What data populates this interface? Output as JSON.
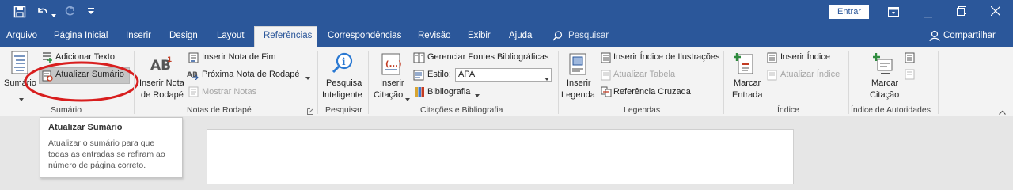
{
  "titlebar": {
    "signin_label": "Entrar"
  },
  "tabs": {
    "arquivo": "Arquivo",
    "pagina_inicial": "Página Inicial",
    "inserir": "Inserir",
    "design": "Design",
    "layout": "Layout",
    "referencias": "Referências",
    "correspondencias": "Correspondências",
    "revisao": "Revisão",
    "exibir": "Exibir",
    "ajuda": "Ajuda",
    "search_label": "Pesquisar",
    "share_label": "Compartilhar"
  },
  "ribbon": {
    "sumario": {
      "button_label": "Sumário",
      "adicionar_texto": "Adicionar Texto",
      "atualizar_sumario": "Atualizar Sumário",
      "group_label": "Sumário"
    },
    "notas": {
      "inserir_nota_rodape_line1": "Inserir Nota",
      "inserir_nota_rodape_line2": "de Rodapé",
      "inserir_nota_fim": "Inserir Nota de Fim",
      "proxima_nota": "Próxima Nota de Rodapé",
      "mostrar_notas": "Mostrar Notas",
      "group_label": "Notas de Rodapé"
    },
    "pesquisar": {
      "pesquisa_line1": "Pesquisa",
      "pesquisa_line2": "Inteligente",
      "group_label": "Pesquisar"
    },
    "citacoes": {
      "inserir_citacao_line1": "Inserir",
      "inserir_citacao_line2": "Citação",
      "gerenciar_fontes": "Gerenciar Fontes Bibliográficas",
      "estilo_label": "Estilo:",
      "estilo_value": "APA",
      "bibliografia": "Bibliografia",
      "group_label": "Citações e Bibliografia"
    },
    "legendas": {
      "inserir_legenda_line1": "Inserir",
      "inserir_legenda_line2": "Legenda",
      "inserir_indice_ilustracoes": "Inserir Índice de Ilustrações",
      "atualizar_tabela": "Atualizar Tabela",
      "referencia_cruzada": "Referência Cruzada",
      "group_label": "Legendas"
    },
    "indice": {
      "marcar_entrada_line1": "Marcar",
      "marcar_entrada_line2": "Entrada",
      "inserir_indice": "Inserir Índice",
      "atualizar_indice": "Atualizar Índice",
      "group_label": "Índice"
    },
    "autoridades": {
      "marcar_citacao_line1": "Marcar",
      "marcar_citacao_line2": "Citação",
      "group_label": "Índice de Autoridades"
    }
  },
  "tooltip": {
    "title": "Atualizar Sumário",
    "line1": "Atualizar o sumário para que",
    "line2": "todas as entradas se refiram ao",
    "line3": "número de página correto."
  },
  "colors": {
    "title_bar": "#2b579a",
    "ribbon": "#f3f3f3",
    "highlight": "#c5c5c5",
    "annotation_circle": "#d81e1e"
  }
}
